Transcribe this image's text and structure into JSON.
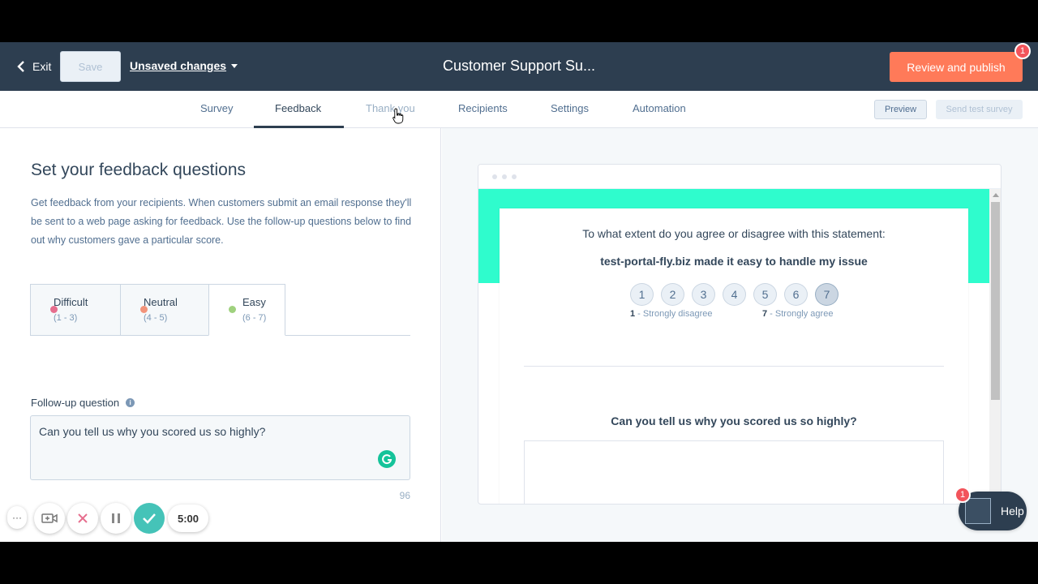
{
  "header": {
    "exit_label": "Exit",
    "save_label": "Save",
    "unsaved_label": "Unsaved changes",
    "title": "Customer Support Su...",
    "publish_label": "Review and publish",
    "notification_count": "1"
  },
  "tabs": [
    {
      "label": "Survey"
    },
    {
      "label": "Feedback"
    },
    {
      "label": "Thank you"
    },
    {
      "label": "Recipients"
    },
    {
      "label": "Settings"
    },
    {
      "label": "Automation"
    }
  ],
  "toolbar": {
    "preview_label": "Preview",
    "send_test_label": "Send test survey"
  },
  "left": {
    "heading": "Set your feedback questions",
    "description": "Get feedback from your recipients. When customers submit an email response they'll be sent to a web page asking for feedback. Use the follow-up questions below to find out why customers gave a particular score.",
    "score_tabs": [
      {
        "label": "Difficult",
        "range": "(1 - 3)",
        "color": "#e66e8e"
      },
      {
        "label": "Neutral",
        "range": "(4 - 5)",
        "color": "#f2937a"
      },
      {
        "label": "Easy",
        "range": "(6 - 7)",
        "color": "#9fd17e"
      }
    ],
    "followup_label": "Follow-up question",
    "followup_value": "Can you tell us why you scored us so highly?",
    "char_count": "96"
  },
  "recorder": {
    "more_label": "···",
    "timer": "5:00"
  },
  "preview": {
    "question_intro": "To what extent do you agree or disagree with this statement:",
    "statement": "test-portal-fly.biz made it easy to handle my issue",
    "scale": [
      "1",
      "2",
      "3",
      "4",
      "5",
      "6",
      "7"
    ],
    "selected_value": "7",
    "low_num": "1",
    "low_label": " - Strongly disagree",
    "high_num": "7",
    "high_label": " - Strongly agree",
    "followup_question": "Can you tell us why you scored us so highly?"
  },
  "help": {
    "label": "Help",
    "badge_count": "1"
  },
  "colors": {
    "header_bg": "#2d3e50",
    "accent_orange": "#ff7a59",
    "preview_teal": "#2ffccd",
    "recorder_green": "#45c3b8"
  }
}
